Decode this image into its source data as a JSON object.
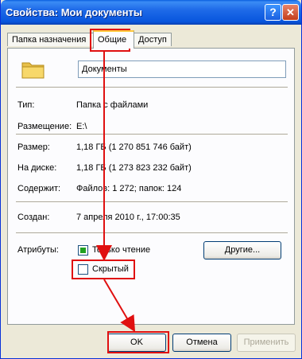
{
  "window": {
    "title": "Свойства: Мои документы"
  },
  "tabs": [
    {
      "label": "Папка назначения"
    },
    {
      "label": "Общие"
    },
    {
      "label": "Доступ"
    }
  ],
  "general": {
    "folder_name": "Документы",
    "type_label": "Тип:",
    "type_value": "Папка с файлами",
    "location_label": "Размещение:",
    "location_value": "E:\\",
    "size_label": "Размер:",
    "size_value": "1,18 ГБ (1 270 851 746 байт)",
    "disk_label": "На диске:",
    "disk_value": "1,18 ГБ (1 273 823 232 байт)",
    "contains_label": "Содержит:",
    "contains_value": "Файлов: 1 272; папок: 124",
    "created_label": "Создан:",
    "created_value": "7 апреля 2010 г., 17:00:35",
    "attributes_label": "Атрибуты:",
    "readonly_label": "Только чтение",
    "hidden_label": "Скрытый",
    "other_button": "Другие..."
  },
  "buttons": {
    "ok": "OK",
    "cancel": "Отмена",
    "apply": "Применить"
  },
  "colors": {
    "annotation": "#e01010",
    "titlebar": "#0a5fe0",
    "dialog_bg": "#ece9d8"
  },
  "annotation": {
    "highlighted": [
      "tab-general",
      "hidden-attribute",
      "ok-button"
    ],
    "checkbox_states": {
      "readonly": true,
      "hidden": false
    }
  }
}
